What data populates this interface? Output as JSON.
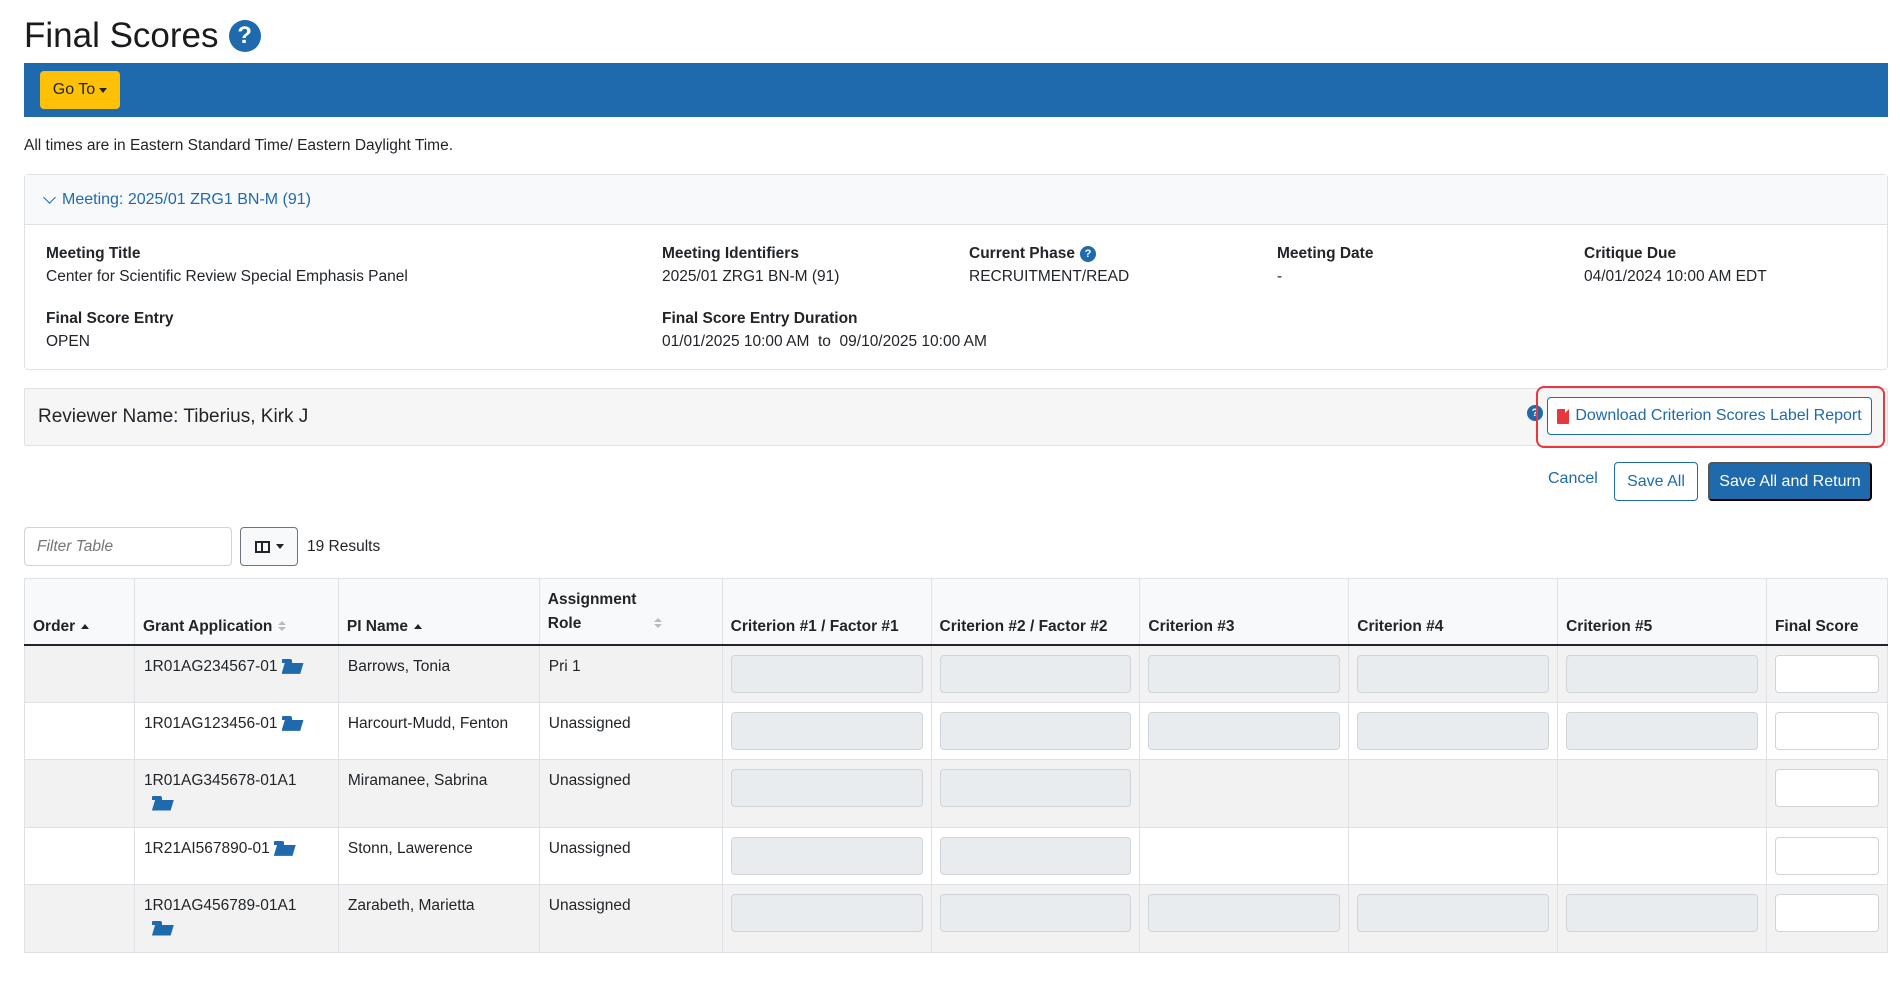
{
  "page": {
    "title": "Final Scores"
  },
  "toolbar": {
    "goto_label": "Go To"
  },
  "timezone_note": "All times are in Eastern Standard Time/ Eastern Daylight Time.",
  "meeting": {
    "header": "Meeting:  2025/01 ZRG1 BN-M (91)",
    "fields": {
      "title_label": "Meeting Title",
      "title_value": "Center for Scientific Review Special Emphasis Panel",
      "identifiers_label": "Meeting Identifiers",
      "identifiers_value": "2025/01 ZRG1 BN-M (91)",
      "phase_label": "Current Phase",
      "phase_value": "RECRUITMENT/READ",
      "date_label": "Meeting Date",
      "date_value": "-",
      "critique_label": "Critique Due",
      "critique_value": "04/01/2024 10:00 AM EDT",
      "entry_label": "Final Score Entry",
      "entry_value": "OPEN",
      "duration_label": "Final Score Entry Duration",
      "duration_value": "01/01/2025 10:00 AM  to  09/10/2025 10:00 AM"
    }
  },
  "reviewer": {
    "name": "Reviewer Name: Tiberius, Kirk J"
  },
  "actions": {
    "download_label": "Download Criterion Scores Label Report",
    "cancel_label": "Cancel",
    "save_all_label": "Save All",
    "save_return_label": "Save All and Return"
  },
  "filter": {
    "placeholder": "Filter Table",
    "results": "19 Results"
  },
  "table": {
    "headers": [
      "Order",
      "Grant Application",
      "PI Name",
      "Assignment Role",
      "Criterion #1 / Factor #1",
      "Criterion #2 / Factor #2",
      "Criterion #3",
      "Criterion #4",
      "Criterion #5",
      "Final Score"
    ],
    "rows": [
      {
        "order": "",
        "grant": "1R01AG234567-01",
        "pi": "Barrows, Tonia",
        "role": "Pri 1",
        "criteria_fields": 5,
        "final_score": ""
      },
      {
        "order": "",
        "grant": "1R01AG123456-01",
        "pi": "Harcourt-Mudd, Fenton",
        "role": "Unassigned",
        "criteria_fields": 5,
        "final_score": ""
      },
      {
        "order": "",
        "grant": "1R01AG345678-01A1",
        "pi": "Miramanee, Sabrina",
        "role": "Unassigned",
        "criteria_fields": 2,
        "final_score": ""
      },
      {
        "order": "",
        "grant": "1R21AI567890-01",
        "pi": "Stonn, Lawerence",
        "role": "Unassigned",
        "criteria_fields": 2,
        "final_score": ""
      },
      {
        "order": "",
        "grant": "1R01AG456789-01A1",
        "pi": "Zarabeth, Marietta",
        "role": "Unassigned",
        "criteria_fields": 5,
        "final_score": ""
      }
    ]
  }
}
